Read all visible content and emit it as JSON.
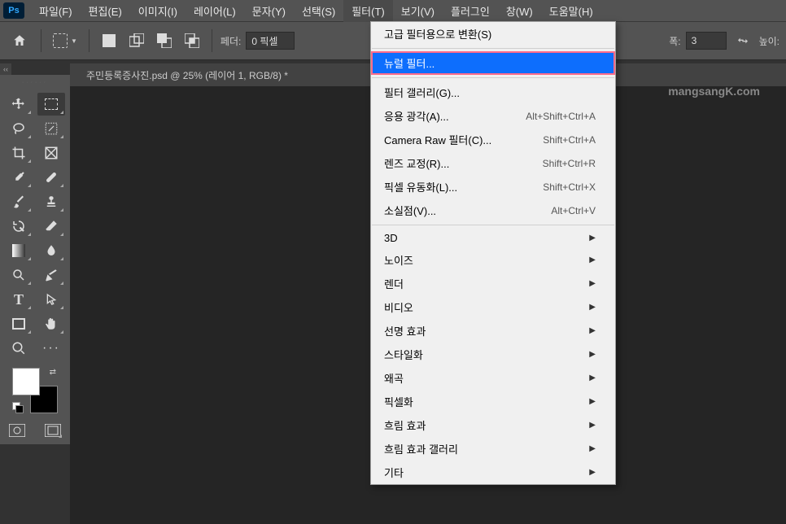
{
  "app": {
    "logo": "Ps"
  },
  "menubar": [
    "파일(F)",
    "편집(E)",
    "이미지(I)",
    "레이어(L)",
    "문자(Y)",
    "선택(S)",
    "필터(T)",
    "보기(V)",
    "플러그인",
    "창(W)",
    "도움말(H)"
  ],
  "menubar_active_index": 6,
  "options": {
    "feather_label": "페더:",
    "feather_value": "0 픽셀",
    "width_label": "폭:",
    "width_value": "3",
    "height_label": "높이:"
  },
  "document": {
    "tab_title": "주민등록증사진.psd @ 25% (레이어 1, RGB/8) *"
  },
  "watermark": "mangsangK.com",
  "filter_menu": {
    "sections": [
      [
        {
          "label": "고급 필터용으로 변환(S)",
          "shortcut": "",
          "submenu": false
        }
      ],
      [
        {
          "label": "뉴럴 필터...",
          "shortcut": "",
          "submenu": false,
          "highlighted": true
        }
      ],
      [
        {
          "label": "필터 갤러리(G)...",
          "shortcut": "",
          "submenu": false
        },
        {
          "label": "응용 광각(A)...",
          "shortcut": "Alt+Shift+Ctrl+A",
          "submenu": false
        },
        {
          "label": "Camera Raw 필터(C)...",
          "shortcut": "Shift+Ctrl+A",
          "submenu": false
        },
        {
          "label": "렌즈 교정(R)...",
          "shortcut": "Shift+Ctrl+R",
          "submenu": false
        },
        {
          "label": "픽셀 유동화(L)...",
          "shortcut": "Shift+Ctrl+X",
          "submenu": false
        },
        {
          "label": "소실점(V)...",
          "shortcut": "Alt+Ctrl+V",
          "submenu": false
        }
      ],
      [
        {
          "label": "3D",
          "shortcut": "",
          "submenu": true
        },
        {
          "label": "노이즈",
          "shortcut": "",
          "submenu": true
        },
        {
          "label": "렌더",
          "shortcut": "",
          "submenu": true
        },
        {
          "label": "비디오",
          "shortcut": "",
          "submenu": true
        },
        {
          "label": "선명 효과",
          "shortcut": "",
          "submenu": true
        },
        {
          "label": "스타일화",
          "shortcut": "",
          "submenu": true
        },
        {
          "label": "왜곡",
          "shortcut": "",
          "submenu": true
        },
        {
          "label": "픽셀화",
          "shortcut": "",
          "submenu": true
        },
        {
          "label": "흐림 효과",
          "shortcut": "",
          "submenu": true
        },
        {
          "label": "흐림 효과 갤러리",
          "shortcut": "",
          "submenu": true
        },
        {
          "label": "기타",
          "shortcut": "",
          "submenu": true
        }
      ]
    ]
  }
}
